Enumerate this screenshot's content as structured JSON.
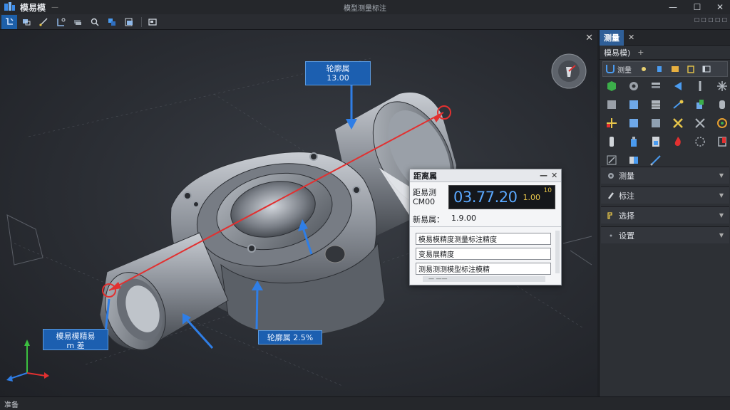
{
  "app": {
    "name": "模易模",
    "window_title": "模型测量标注",
    "small_menu": "—"
  },
  "window_controls": {
    "minimize": "—",
    "maximize": "☐",
    "close": "✕"
  },
  "toolbar": {
    "tools": [
      "select-tool",
      "pan-tool",
      "measure-tool",
      "dimension-tool",
      "layer-tool",
      "zoom-tool",
      "material-tool",
      "export-tool",
      "snapshot-tool"
    ],
    "active_tool": "select-tool"
  },
  "viewport": {
    "close_label": "✕",
    "callouts": {
      "top": {
        "line1": "轮廓属",
        "line2": "13.00"
      },
      "left": {
        "line1": "模易模精易",
        "line2": "m 差"
      },
      "bottom": {
        "line1": "轮廓属 2.5%"
      }
    },
    "axes": {
      "x": "X",
      "y": "Y",
      "z": "Z"
    }
  },
  "measurement_popup": {
    "title": "距离属",
    "minimize": "—",
    "close": "✕",
    "label_line1": "距易测",
    "label_line2": "CM00",
    "readout_value": "03.77.20",
    "readout_unit": "1.00",
    "readout_sup": "10",
    "row2_label": "新易属：",
    "row2_value": "1.9.00",
    "list_items": [
      "模易模精度测量标注精度",
      "变易展精度",
      "测易测测模型标注模精"
    ],
    "hbar_text": "— ——"
  },
  "panel": {
    "top_right_icons": "☐ ☐ ☐ ☐ ☐",
    "tab_label": "测量",
    "tab_close": "✕",
    "sub_label": "模易模)",
    "sub_plus": "+",
    "grid_head_label": "测量",
    "sections": [
      {
        "label": "测量",
        "icon": "gear-icon"
      },
      {
        "label": "标注",
        "icon": "brush-icon"
      },
      {
        "label": "选择",
        "icon": "select-icon"
      },
      {
        "label": "设置",
        "icon": "dot-icon"
      }
    ]
  },
  "status_bar": {
    "text": "准备"
  }
}
